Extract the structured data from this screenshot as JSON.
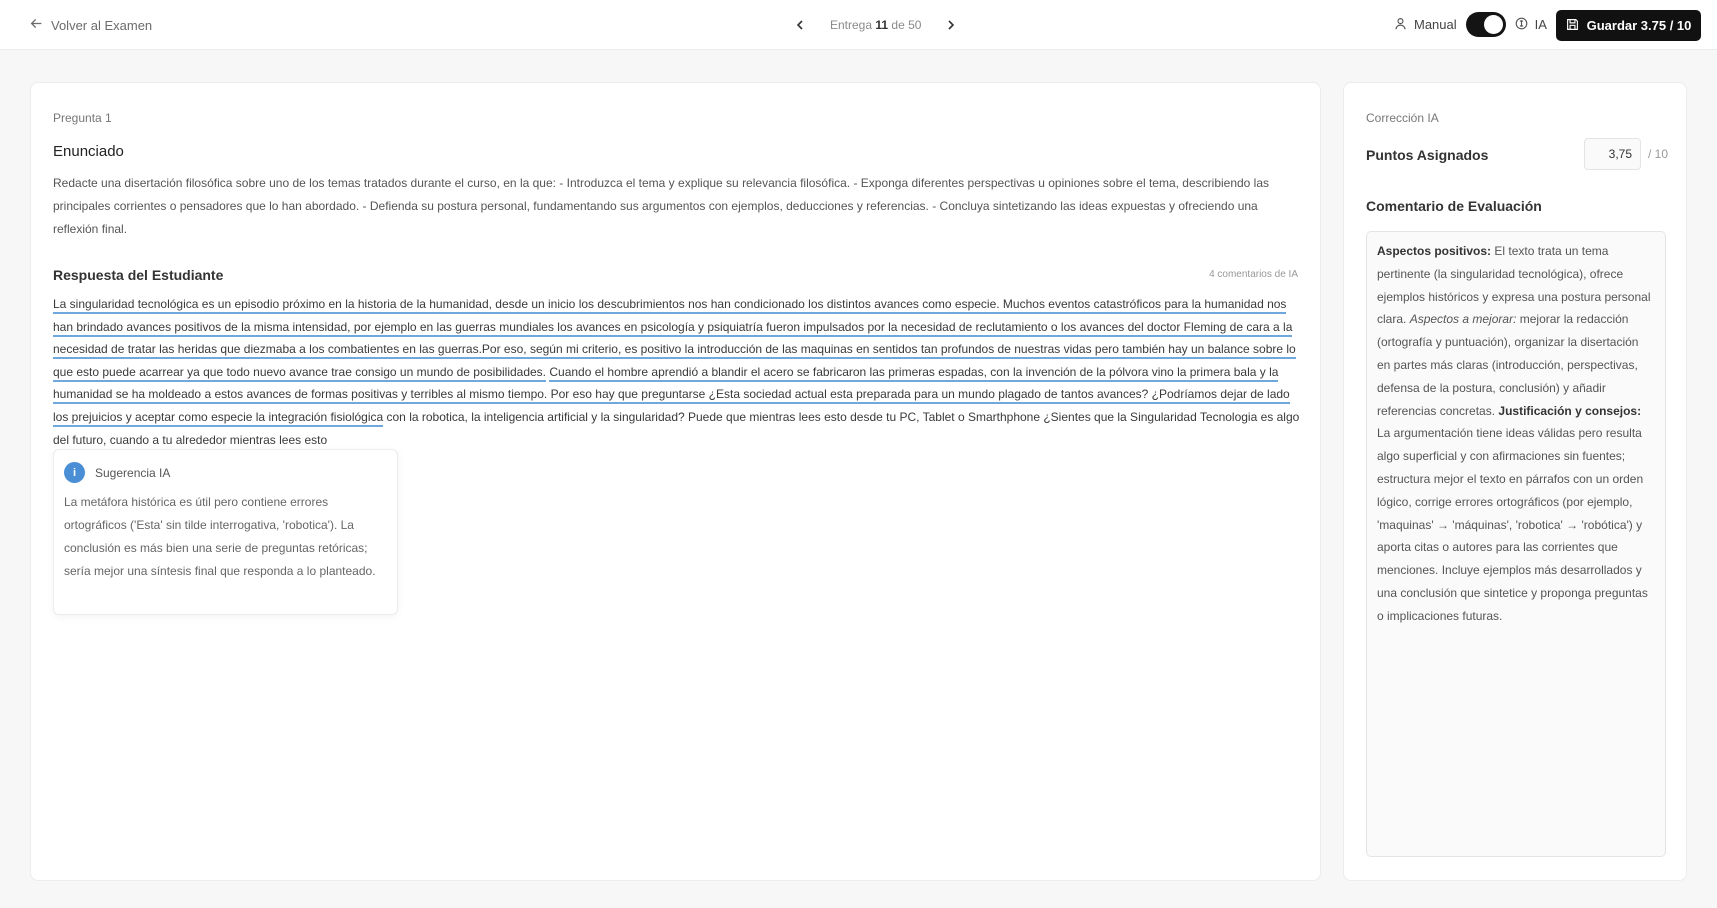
{
  "header": {
    "back_label": "Volver al Examen",
    "pager": {
      "prefix": "Entrega",
      "current": "11",
      "middle": "de",
      "total": "50"
    },
    "mode_manual": "Manual",
    "mode_ai": "IA",
    "save_label": "Guardar 3.75 / 10"
  },
  "question": {
    "label": "Pregunta 1",
    "heading": "Enunciado",
    "text": "Redacte una disertación filosófica sobre uno de los temas tratados durante el curso, en la que: - Introduzca el tema y explique su relevancia filosófica. - Exponga diferentes perspectivas u opiniones sobre el tema, describiendo las principales corrientes o pensadores que lo han abordado. - Defienda su postura personal, fundamentando sus argumentos con ejemplos, deducciones y referencias. - Concluya sintetizando las ideas expuestas y ofreciendo una reflexión final."
  },
  "answer": {
    "heading": "Respuesta del Estudiante",
    "ai_comments": "4 comentarios de IA",
    "segments": [
      {
        "text": "La singularidad tecnológica es un episodio próximo en la historia de la humanidad, ",
        "hl": true
      },
      {
        "text": "desde un inicio los descubrimientos nos han condicionado los distintos avances como especie. Muchos eventos catastróficos para la humanidad nos han brindado avances positivos de la misma intensidad, por ejemplo en las guerras mundiales los avances en psicología y psiquiatría fueron impulsados por la necesidad de reclutamiento o los avances del doctor Fleming de cara a la necesidad de tratar las heridas que diezmaba a los combatientes en las guerras.",
        "hl": true
      },
      {
        "text": "Por eso, según mi criterio, es positivo la introducción de las maquinas en sentidos tan profundos de nuestras vidas pero también hay un balance sobre lo que esto puede acarrear ya que todo nuevo avance trae consigo un mundo de posibilidades.",
        "hl": true
      },
      {
        "text": " ",
        "hl": false
      },
      {
        "text": "Cuando el hombre aprendió a blandir el acero se fabricaron las primeras espadas, con la invención de la pólvora vino la primera bala y la humanidad se ha moldeado a estos avances de formas positivas y terribles al mismo tiempo. Por eso hay que preguntarse ¿Esta sociedad actual esta preparada para un mundo plagado de tantos avances? ¿Podríamos dejar de lado los prejuicios y aceptar como especie la integración fisiológica",
        "hl": true
      },
      {
        "text": " con la robotica, la inteligencia artificial y la singularidad? Puede que mientras lees esto desde tu PC, Tablet o Smarthphone ¿Sientes que la Singularidad Tecnologia es algo del futuro, cuando a tu alrededor mientras lees esto",
        "hl": false
      }
    ]
  },
  "suggestion": {
    "badge": "i",
    "title": "Sugerencia IA",
    "text": "La metáfora histórica es útil pero contiene errores ortográficos ('Esta' sin tilde interrogativa, 'robotica'). La conclusión es más bien una serie de preguntas retóricas; sería mejor una síntesis final que responda a lo planteado."
  },
  "correction": {
    "label": "Corrección IA",
    "points_label": "Puntos Asignados",
    "points_value": "3,75",
    "points_max": "/ 10",
    "comment_label": "Comentario de Evaluación",
    "comment": {
      "pos_title": "Aspectos positivos:",
      "pos_text": " El texto trata un tema pertinente (la singularidad tecnológica), ofrece ejemplos históricos y expresa una postura personal clara. ",
      "imp_title": "Aspectos a mejorar:",
      "imp_text": " mejorar la redacción (ortografía y puntuación), organizar la disertación en partes más claras (introducción, perspectivas, defensa de la postura, conclusión) y añadir referencias concretas. ",
      "just_title": "Justificación y consejos:",
      "just_text": " La argumentación tiene ideas válidas pero resulta algo superficial y con afirmaciones sin fuentes; estructura mejor el texto en párrafos con un orden lógico, corrige errores ortográficos (por ejemplo, 'maquinas' → 'máquinas', 'robotica' → 'robótica') y aporta citas o autores para las corrientes que menciones. Incluye ejemplos más desarrollados y una conclusión que sintetice y proponga preguntas o implicaciones futuras."
    }
  }
}
